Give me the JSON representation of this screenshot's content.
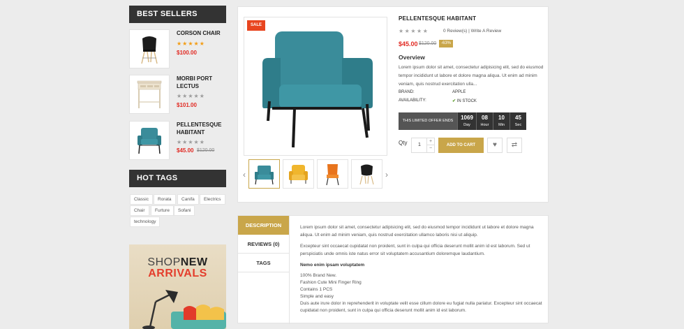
{
  "sidebar": {
    "best_sellers_title": "BEST SELLERS",
    "best_sellers": [
      {
        "name": "CORSON CHAIR",
        "rating": 5,
        "price": "$100.00",
        "old_price": ""
      },
      {
        "name": "MORBI PORT LECTUS",
        "rating": 0,
        "price": "$101.00",
        "old_price": ""
      },
      {
        "name": "PELLENTESQUE HABITANT",
        "rating": 0,
        "price": "$45.00",
        "old_price": "$120.00"
      }
    ],
    "hot_tags_title": "HOT TAGS",
    "tags": [
      "Classic",
      "Rorata",
      "Canifa",
      "Electrics",
      "Chair",
      "Furture",
      "Sofani",
      "technology"
    ],
    "banner": {
      "line1_a": "SHOP",
      "line1_b": "NEW",
      "line2": "ARRIVALS"
    }
  },
  "product": {
    "sale_badge": "SALE",
    "title": "PELLENTESQUE HABITANT",
    "rating": 0,
    "review_text": "0 Review(s) | Write A Review",
    "price": "$45.00",
    "old_price": "$120.00",
    "discount": "-63%",
    "overview_label": "Overview",
    "overview_text": "Lorem ipsum dolor sit amet, consectetur adipisicing elit, sed do eiusmod tempor incididunt ut labore et dolore magna aliqua. Ut enim ad minim veniam, quis nostrud exercitation ulla...",
    "brand_label": "BRAND:",
    "brand_value": "APPLE",
    "availability_label": "AVAILABILITY:",
    "availability_value": "IN STOCK",
    "offer_label": "THIS LIMITED OFFER ENDS",
    "countdown": [
      {
        "value": "1069",
        "unit": "Day"
      },
      {
        "value": "08",
        "unit": "Hour"
      },
      {
        "value": "10",
        "unit": "Min"
      },
      {
        "value": "45",
        "unit": "Sec"
      }
    ],
    "qty_label": "Qty",
    "qty_value": "1",
    "qty_up": "+",
    "qty_down": "−",
    "add_to_cart": "ADD TO CART",
    "thumb_colors": [
      "#3a8c9a",
      "#f0b62d",
      "#e8741d",
      "#222222"
    ]
  },
  "tabs": {
    "items": [
      "DESCRIPTION",
      "REVIEWS (0)",
      "TAGS"
    ],
    "para1": "Lorem ipsum dolor sit amet, consectetur adipisicing elit, sed do eiusmod tempor incididunt ut labore et dolore magna aliqua. Ut enim ad minim veniam, quis nostrud exercitation ullamco laboris nisi ut aliquip.",
    "para2": "Excepteur sint occaecat cupidatat non proident, sunt in culpa qui officia deserunt mollit anim id est laborum. Sed ut perspiciatis unde omnis iste natus error sit voluptatem accusantium doloremque laudantium.",
    "subhead": "Nemo enim ipsam voluptatem",
    "lines": [
      "100% Brand New.",
      "Fashion Cute Mini Finger Ring",
      "Contains 1 PCS",
      "Simple and easy"
    ],
    "para3": "Duis aute irure dolor in reprehenderit in voluptate velit esse cillum dolore eu fugiat nulla pariatur. Excepteur sint occaecat cupidatat non proident, sunt in culpa qui officia deserunt mollit anim id est laborum."
  },
  "colors": {
    "accent": "#c9a64a",
    "dark": "#333333",
    "sale": "#e8451f",
    "price": "#e12a23",
    "star": "#f39c12"
  }
}
